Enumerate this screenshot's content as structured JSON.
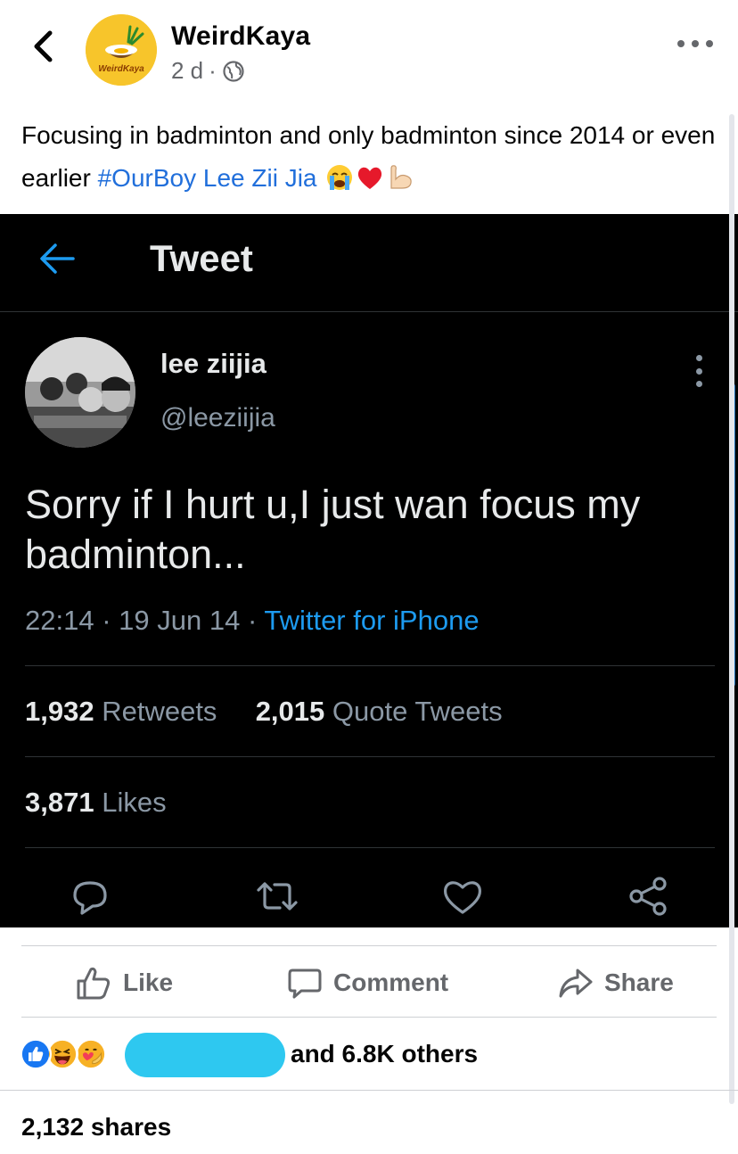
{
  "header": {
    "page_name": "WeirdKaya",
    "logo_text": "WeirdKaya",
    "time": "2 d",
    "separator": "·",
    "privacy_icon": "globe-icon"
  },
  "caption": {
    "text": "Focusing in badminton and only badminton since 2014 or even earlier ",
    "hashtag": "#OurBoy",
    "mention": " Lee Zii Jia",
    "emojis": [
      "crying-face",
      "red-heart",
      "flexed-biceps"
    ]
  },
  "tweet": {
    "screen_title": "Tweet",
    "display_name": "lee ziijia",
    "handle": "@leeziijia",
    "body": "Sorry if I hurt u,I just wan focus my badminton...",
    "time": "22:14",
    "date": "19 Jun 14",
    "source": "Twitter for iPhone",
    "dot": "·",
    "retweets_count": "1,932",
    "retweets_label": "Retweets",
    "quotes_count": "2,015",
    "quotes_label": "Quote Tweets",
    "likes_count": "3,871",
    "likes_label": "Likes",
    "colors": {
      "background": "#000000",
      "accent": "#1d9bf0",
      "muted": "#8b98a5"
    }
  },
  "actions": {
    "like": "Like",
    "comment": "Comment",
    "share": "Share"
  },
  "reactions": {
    "types": [
      "like",
      "haha",
      "care"
    ],
    "text": "and 6.8K others"
  },
  "shares": "2,132 shares"
}
